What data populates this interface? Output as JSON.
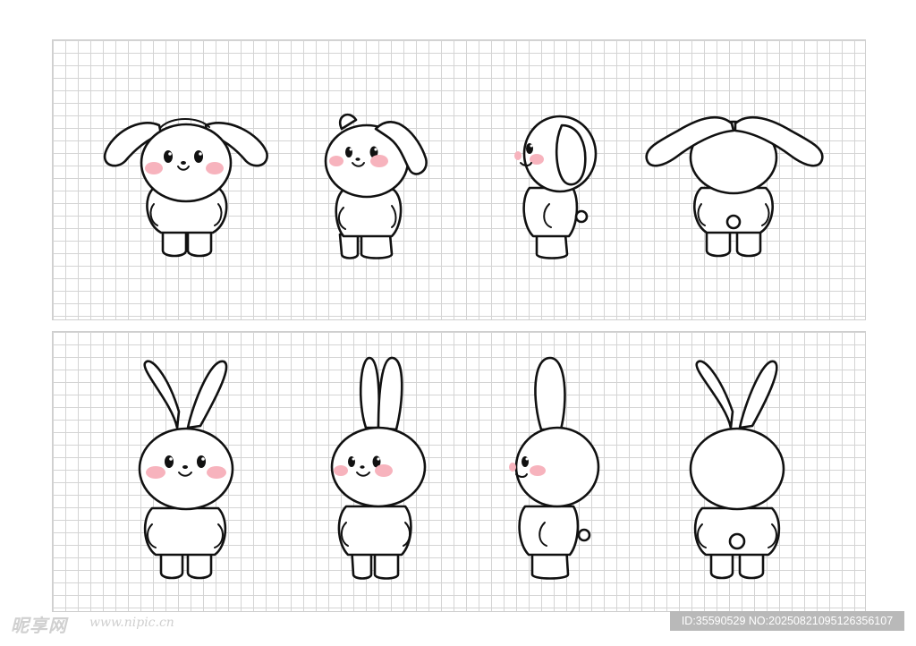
{
  "sheet": {
    "rows": [
      {
        "id": "puppy",
        "views": [
          "front",
          "three-quarter",
          "side",
          "back"
        ]
      },
      {
        "id": "bunny",
        "views": [
          "front",
          "three-quarter",
          "side",
          "back"
        ]
      }
    ]
  },
  "colors": {
    "background": "#ffffff",
    "grid_line": "#d4d4d4",
    "outline": "#111111",
    "blush": "#f7b3bd",
    "id_bar": "#b9b9b9"
  },
  "watermark": {
    "logo": "昵享网",
    "url": "www.nipic.cn",
    "id_text": "ID:35590529 NO:20250821095126356107"
  }
}
